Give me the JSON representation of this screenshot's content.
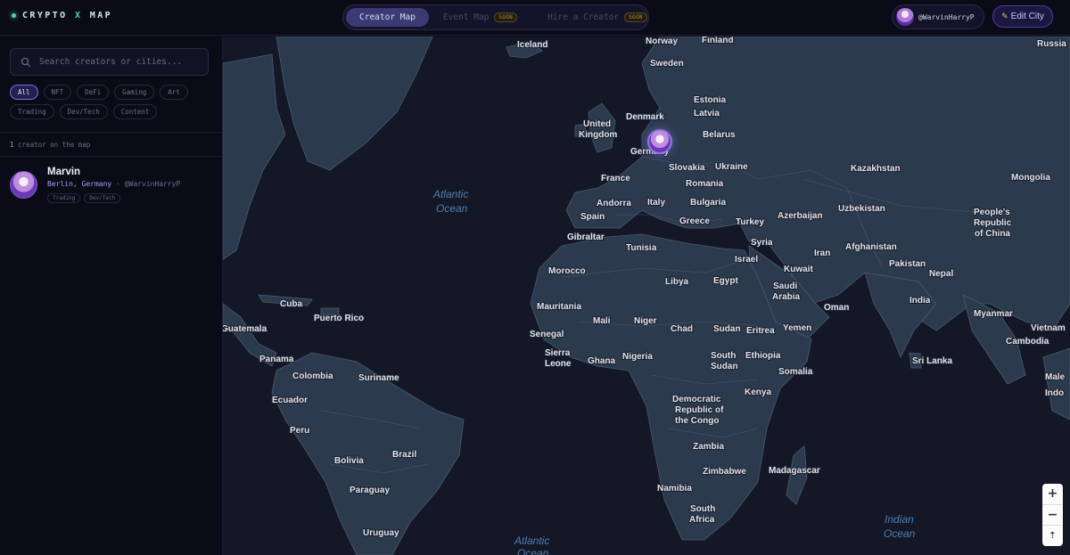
{
  "brand": {
    "prefix": "CRYPTO ",
    "x": "X",
    "suffix": " MAP"
  },
  "tabs": [
    {
      "label": "Creator Map",
      "active": true,
      "badge": ""
    },
    {
      "label": "Event Map",
      "active": false,
      "badge": "SOON"
    },
    {
      "label": "Hire a Creator",
      "active": false,
      "badge": "SOON"
    }
  ],
  "user": {
    "handle": "@WarvinHarryP"
  },
  "edit_city": {
    "label": "Edit City",
    "icon": "pencil-icon"
  },
  "sidebar": {
    "search_placeholder": "Search creators or cities...",
    "filters": [
      "All",
      "NFT",
      "DeFi",
      "Gaming",
      "Art",
      "Trading",
      "Dev/Tech",
      "Content"
    ],
    "active_filter": "All",
    "count_number": "1",
    "count_text": " creator on the map",
    "creators": [
      {
        "name": "Marvin",
        "location": "Berlin, Germany",
        "handle": "@WarvinHarryP",
        "tags": [
          "Trading",
          "Dev/Tech"
        ]
      }
    ]
  },
  "map": {
    "countries": [
      "Iceland",
      "Norway",
      "Finland",
      "Russia",
      "Sweden",
      "Estonia",
      "Latvia",
      "Denmark",
      "United",
      "Kingdom",
      "Belarus",
      "Germany",
      "Slovakia",
      "Ukraine",
      "Kazakhstan",
      "France",
      "Romania",
      "Mongolia",
      "Andorra",
      "Italy",
      "Bulgaria",
      "Uzbekistan",
      "Spain",
      "Greece",
      "Turkey",
      "Azerbaijan",
      "People's",
      "Republic",
      "of China",
      "Gibraltar",
      "Syria",
      "Afghanistan",
      "Tunisia",
      "Iran",
      "Israel",
      "Pakistan",
      "Kuwait",
      "Morocco",
      "Nepal",
      "Saudi",
      "Arabia",
      "Libya",
      "Egypt",
      "India",
      "Oman",
      "Myanmar",
      "Cuba",
      "Mauritania",
      "Mali",
      "Niger",
      "Puerto Rico",
      "Vietnam",
      "Chad",
      "Sudan",
      "Eritrea",
      "Yemen",
      "Guatemala",
      "Senegal",
      "Cambodia",
      "Sierra",
      "Leone",
      "Ghana",
      "Nigeria",
      "South",
      "Sudan",
      "Ethiopia",
      "Panama",
      "Sri Lanka",
      "Colombia",
      "Suriname",
      "Somalia",
      "Kenya",
      "Ecuador",
      "Democratic",
      "Republic of",
      "the Congo",
      "Peru",
      "Zambia",
      "Brazil",
      "Bolivia",
      "Zimbabwe",
      "Madagascar",
      "Namibia",
      "Paraguay",
      "South",
      "Africa",
      "Uruguay",
      "Male",
      "Indo"
    ],
    "oceans": [
      "Atlantic",
      "Ocean",
      "Atlantic",
      "Ocean",
      "Indian",
      "Ocean"
    ],
    "zoom_in": "+",
    "zoom_out": "−",
    "reset_north": "⇡"
  }
}
